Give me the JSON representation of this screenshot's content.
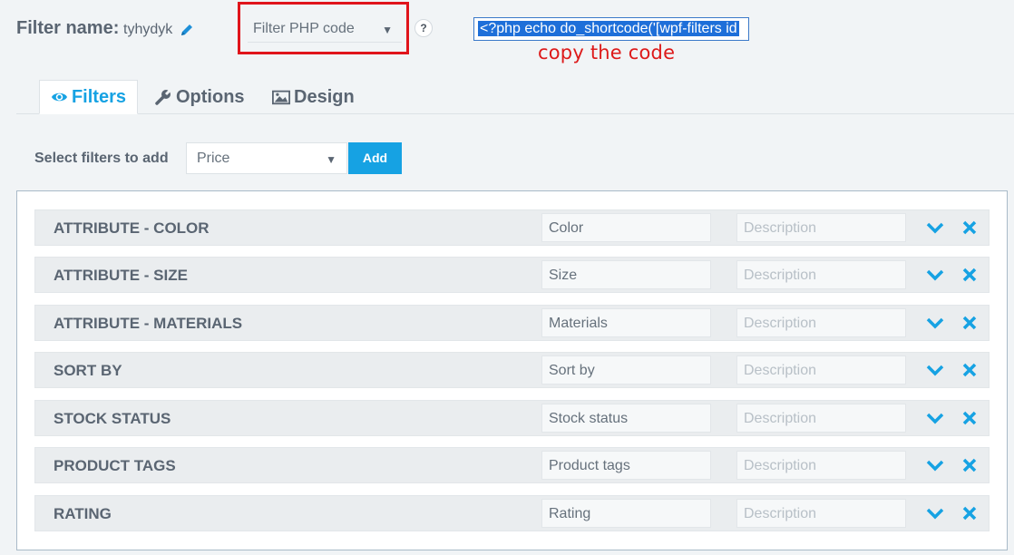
{
  "header": {
    "filter_name_label": "Filter name:",
    "filter_name_value": "tyhydyk",
    "php_select_value": "Filter PHP code",
    "help_label": "?",
    "shortcode_text": "<?php echo do_shortcode('[wpf-filters id",
    "copy_note": "copy the code"
  },
  "tabs": [
    {
      "label": "Filters",
      "icon": "eye-icon"
    },
    {
      "label": "Options",
      "icon": "wrench-icon"
    },
    {
      "label": "Design",
      "icon": "image-icon"
    }
  ],
  "add_filter": {
    "label": "Select filters to add",
    "selected": "Price",
    "button": "Add"
  },
  "filters": [
    {
      "title": "ATTRIBUTE - COLOR",
      "label": "Color",
      "description_placeholder": "Description"
    },
    {
      "title": "ATTRIBUTE - SIZE",
      "label": "Size",
      "description_placeholder": "Description"
    },
    {
      "title": "ATTRIBUTE - MATERIALS",
      "label": "Materials",
      "description_placeholder": "Description"
    },
    {
      "title": "SORT BY",
      "label": "Sort by",
      "description_placeholder": "Description"
    },
    {
      "title": "STOCK STATUS",
      "label": "Stock status",
      "description_placeholder": "Description"
    },
    {
      "title": "PRODUCT TAGS",
      "label": "Product tags",
      "description_placeholder": "Description"
    },
    {
      "title": "RATING",
      "label": "Rating",
      "description_placeholder": "Description"
    }
  ],
  "colors": {
    "accent": "#16a2e3",
    "highlight_border": "#e0141b",
    "note": "#dd1a1a"
  }
}
